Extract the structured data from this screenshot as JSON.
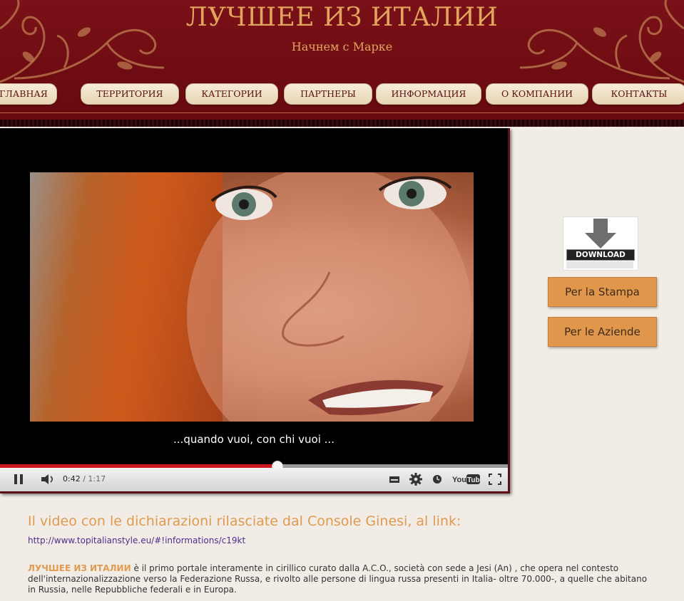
{
  "header": {
    "title": "ЛУЧШЕЕ ИЗ ИТАЛИИ",
    "subtitle": "Начнем с Марке"
  },
  "nav": {
    "items": [
      {
        "label": "ГЛАВНАЯ"
      },
      {
        "label": "ТЕРРИТОРИЯ"
      },
      {
        "label": "КАТЕГОРИИ"
      },
      {
        "label": "ПАРТНЕРЫ"
      },
      {
        "label": "ИНФОРМАЦИЯ"
      },
      {
        "label": "О КОМПАНИИ"
      },
      {
        "label": "КОНТАКТЫ"
      }
    ]
  },
  "video": {
    "subtitle": "...quando vuoi, con chi vuoi ...",
    "current_time": "0:42",
    "duration": "1:17",
    "progress": 0.545,
    "buffered": 1.0,
    "state": "playing",
    "logo": "YouTube"
  },
  "sidebar": {
    "download_label": "DOWNLOAD",
    "buttons": [
      "Per la Stampa",
      "Per le Aziende"
    ]
  },
  "content": {
    "heading": "Il video con le dichiarazioni rilasciate dal Console Ginesi, al link:",
    "link": "http://www.topitalianstyle.eu/#!informations/c19kt",
    "about_brand": "ЛУЧШЕЕ ИЗ ИТАЛИИ",
    "about_text": " è il primo portale interamente in cirillico curato dalla A.C.O., società con sede a Jesi (An) , che opera nel contesto dell'internazionalizzazione verso la Federazione Russa, e rivolto alle persone di lingua russa presenti in Italia- oltre 70.000-, a quelle che abitano in Russia, nelle Repubbliche federali e in Europa."
  },
  "colors": {
    "header_bg": "#6e0d14",
    "gold": "#e3a55d",
    "button_orange": "#e0964b",
    "progress_red": "#cc181e"
  }
}
